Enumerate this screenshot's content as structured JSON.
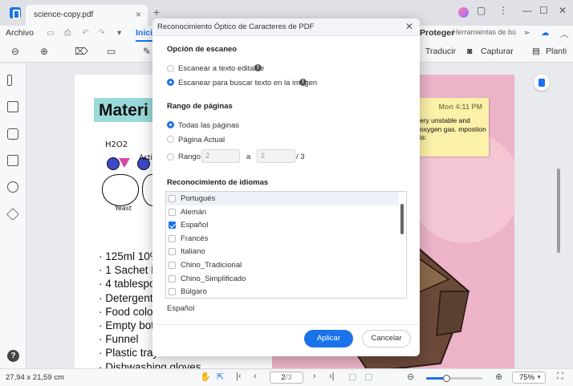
{
  "tab": {
    "title": "science-copy.pdf",
    "close_glyph": "×",
    "new_glyph": "+"
  },
  "window_controls": {
    "minimize": "—",
    "maximize": "☐",
    "close": "✕",
    "more": "⋮",
    "message": "▢"
  },
  "menu": {
    "items": [
      "Archivo",
      "Inicio"
    ],
    "right_items": [
      "Proteger",
      "Herramientas de bú"
    ]
  },
  "toolbar": {
    "translate": "Traducir",
    "capture": "Capturar",
    "templates": "Planti"
  },
  "document": {
    "left": {
      "heading": "Materi",
      "formula": "H2O2",
      "activator": "Acti",
      "yeast": "Yeast",
      "ingredients": [
        "· 125ml 10%",
        "· 1 Sachet D",
        "· 4 tablespo",
        "· Detergent",
        "· Food colo",
        "· Empty bot",
        "· Funnel",
        "· Plastic tray",
        "· Dishwashing gloves"
      ]
    },
    "right": {
      "note_time": "Mon 4:11 PM",
      "note_text": "ery unstable and oxygen gas. mpostion is:"
    }
  },
  "status": {
    "page_size": "27,94 x 21,59 cm",
    "page_current": "2",
    "page_total": "/3",
    "zoom": "75%",
    "zoom_level": 0.35
  },
  "dialog": {
    "title": "Reconocimiento Óptico de Caracteres de PDF",
    "close_glyph": "✕",
    "scan": {
      "heading": "Opción de escaneo",
      "options": [
        "Escanear a texto editable",
        "Escanear para buscar texto en la imagen"
      ],
      "selected": 1
    },
    "pages": {
      "heading": "Rango de páginas",
      "options": [
        "Todas las páginas",
        "Página Actual",
        "Rango"
      ],
      "selected": 0,
      "range_from": "2",
      "range_to": "2",
      "range_sep": "a",
      "range_total": "/ 3"
    },
    "languages": {
      "heading": "Reconocimiento de idiomas",
      "items": [
        {
          "label": "Portugués",
          "checked": false
        },
        {
          "label": "Alemán",
          "checked": false
        },
        {
          "label": "Español",
          "checked": true
        },
        {
          "label": "Francés",
          "checked": false
        },
        {
          "label": "Italiano",
          "checked": false
        },
        {
          "label": "Chino_Tradicional",
          "checked": false
        },
        {
          "label": "Chino_Simplificado",
          "checked": false
        },
        {
          "label": "Búlgaro",
          "checked": false
        }
      ],
      "selected_summary": "Español"
    },
    "apply_label": "Aplicar",
    "cancel_label": "Cancelar"
  },
  "colors": {
    "accent": "#1a73e8",
    "page_right": "#ecb3c9",
    "sticky": "#fbf1a8",
    "band": "#9adada"
  },
  "icons": [
    "app-logo-icon",
    "search-icon",
    "zoom-in-icon",
    "hand-icon",
    "select-icon",
    "first-page-icon",
    "prev-page-icon",
    "next-page-icon",
    "last-page-icon",
    "help-icon",
    "translate-icon",
    "capture-icon",
    "template-icon"
  ]
}
